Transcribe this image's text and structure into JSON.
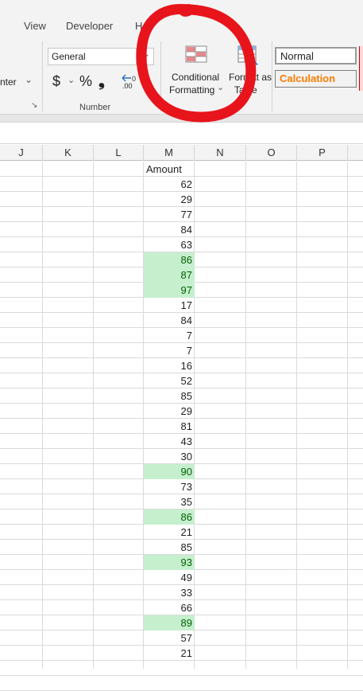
{
  "tabs": [
    "View",
    "Developer",
    "H"
  ],
  "ribbon": {
    "alignment": {
      "merge_label": "nter",
      "merge_caret": "⌄"
    },
    "number": {
      "format_value": "General",
      "currency_symbol": "$",
      "percent_symbol": "%",
      "comma_symbol": "❟",
      "increase_decimal_label": ".00",
      "group_label": "Number",
      "launcher_glyph": "↘"
    },
    "styles": {
      "conditional_formatting_line1": "Conditional",
      "conditional_formatting_line2": "Formatting",
      "caret": "⌄",
      "format_as_table_line1": "Format as",
      "format_as_table_line2": "Table",
      "cell_styles": [
        "Normal",
        "Calculation"
      ]
    }
  },
  "sheet": {
    "columns": [
      "J",
      "K",
      "L",
      "M",
      "N",
      "O",
      "P"
    ],
    "header_cell": "Amount",
    "amounts": [
      "62",
      "29",
      "77",
      "84",
      "63",
      "86",
      "87",
      "97",
      "17",
      "84",
      "7",
      "7",
      "16",
      "52",
      "85",
      "29",
      "81",
      "43",
      "30",
      "90",
      "73",
      "35",
      "86",
      "21",
      "85",
      "93",
      "49",
      "33",
      "66",
      "89",
      "57",
      "21"
    ],
    "highlighted": [
      false,
      false,
      false,
      false,
      false,
      true,
      true,
      true,
      false,
      false,
      false,
      false,
      false,
      false,
      false,
      false,
      false,
      false,
      false,
      true,
      false,
      false,
      true,
      false,
      false,
      true,
      false,
      false,
      false,
      true,
      false,
      false
    ]
  },
  "colors": {
    "highlight_fill": "#c6efce",
    "highlight_text": "#006100",
    "annotation": "#e8141c",
    "calculation_text": "#fa7d00"
  },
  "icons": [
    "conditional-formatting-icon",
    "format-as-table-icon",
    "currency-icon",
    "percent-icon",
    "comma-style-icon",
    "increase-decimal-icon",
    "dialog-launcher-icon"
  ]
}
